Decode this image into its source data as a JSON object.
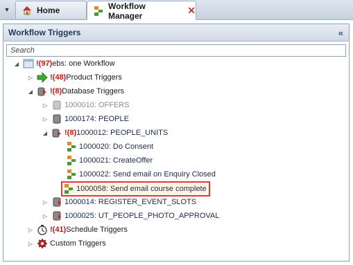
{
  "tabs": [
    {
      "label": "Home",
      "icon": "home-icon"
    },
    {
      "label": "Workflow Manager",
      "icon": "workflow-icon",
      "close": "✕"
    }
  ],
  "dropdown_glyph": "▼",
  "panel": {
    "title": "Workflow Triggers",
    "collapse_glyph": "«",
    "search_placeholder": "Search"
  },
  "tree": {
    "root": {
      "count": "!(97)",
      "label": "ebs: one Workflow"
    },
    "product": {
      "count": "!(48)",
      "label": "Product Triggers"
    },
    "database": {
      "count": "!(8)",
      "label": "Database Triggers"
    },
    "offers": {
      "label": "1000010: OFFERS"
    },
    "people": {
      "label": "1000174: PEOPLE"
    },
    "people_units": {
      "count": "!(8)",
      "label": "1000012: PEOPLE_UNITS"
    },
    "do_consent": {
      "label": "1000020: Do Consent"
    },
    "create_offer": {
      "label": "1000021: CreateOffer"
    },
    "enquiry_closed": {
      "label": "1000022: Send email on Enquiry Closed"
    },
    "course_complete": {
      "label": "1000058: Send email course complete"
    },
    "register_slots": {
      "label": "1000014: REGISTER_EVENT_SLOTS"
    },
    "photo_approval": {
      "label": "1000025: UT_PEOPLE_PHOTO_APPROVAL"
    },
    "schedule": {
      "count": "!(41)",
      "label": "Schedule Triggers"
    },
    "custom": {
      "label": "Custom Triggers"
    }
  },
  "colors": {
    "error_count": "#d01010",
    "selection_border": "#e0383e",
    "header_text": "#1e395b"
  }
}
